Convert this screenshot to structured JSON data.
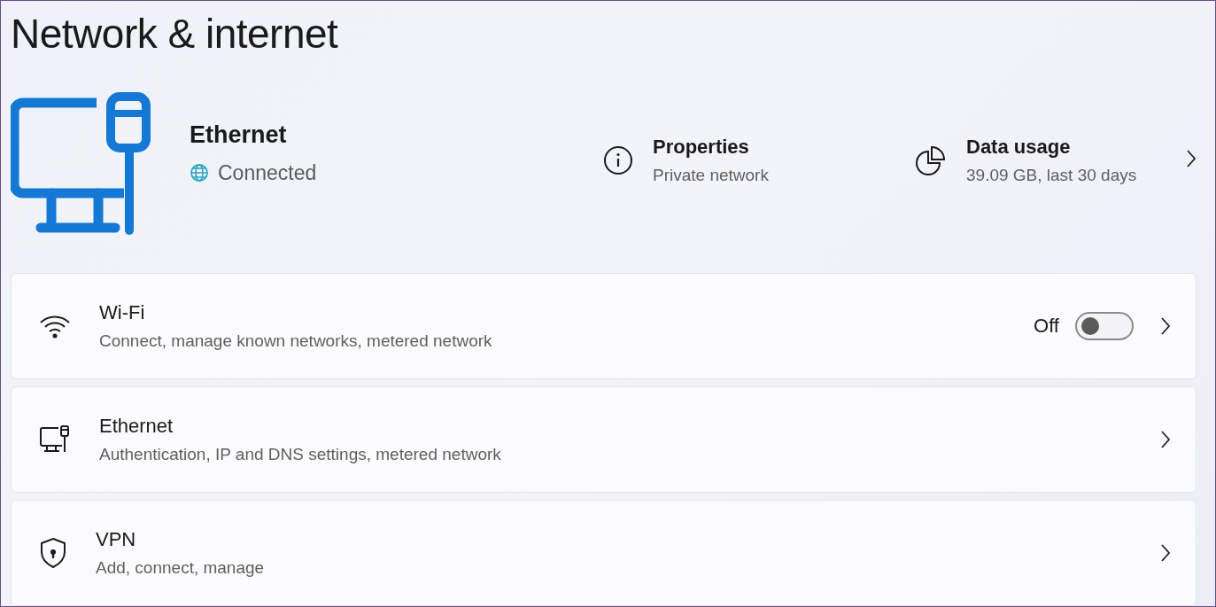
{
  "title": "Network & internet",
  "hero": {
    "name": "Ethernet",
    "status": "Connected",
    "items": [
      {
        "title": "Properties",
        "subtitle": "Private network"
      },
      {
        "title": "Data usage",
        "subtitle": "39.09 GB, last 30 days"
      }
    ]
  },
  "cards": [
    {
      "kind": "toggle",
      "title": "Wi-Fi",
      "subtitle": "Connect, manage known networks, metered network",
      "state_label": "Off",
      "on": false
    },
    {
      "kind": "link",
      "title": "Ethernet",
      "subtitle": "Authentication, IP and DNS settings, metered network"
    },
    {
      "kind": "link",
      "title": "VPN",
      "subtitle": "Add, connect, manage"
    }
  ]
}
